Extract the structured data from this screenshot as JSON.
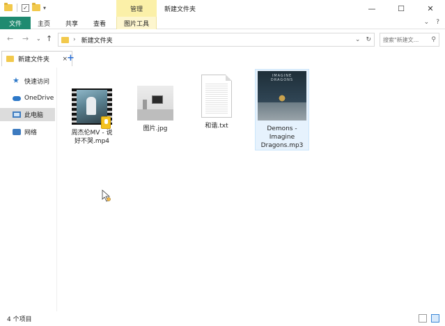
{
  "window": {
    "title": "新建文件夹",
    "context_tab_group": "管理",
    "controls": {
      "minimize": "—",
      "maximize": "☐",
      "close": "✕"
    }
  },
  "quick_access_toolbar": {
    "caret": "▾"
  },
  "ribbon": {
    "tabs": [
      {
        "label": "文件",
        "active": true
      },
      {
        "label": "主页"
      },
      {
        "label": "共享"
      },
      {
        "label": "查看"
      },
      {
        "label": "图片工具",
        "contextual": true
      }
    ],
    "right": {
      "collapse": "⌄",
      "help": "?"
    }
  },
  "address_bar": {
    "path": "新建文件夹",
    "chevron": "›",
    "dropdown": "⌄",
    "refresh": "↻"
  },
  "nav": {
    "back": "←",
    "forward": "→",
    "recent": "⌄",
    "up": "↑"
  },
  "search": {
    "placeholder": "搜索\"新建文...",
    "icon": "⚲"
  },
  "tab_strip": {
    "tabs": [
      {
        "label": "新建文件夹",
        "close": "×"
      }
    ],
    "new_tab": "+"
  },
  "sidebar": {
    "items": [
      {
        "label": "快速访问",
        "icon": "star-icon"
      },
      {
        "label": "OneDrive",
        "icon": "cloud-icon"
      },
      {
        "label": "此电脑",
        "icon": "computer-icon",
        "selected": true
      },
      {
        "label": "网络",
        "icon": "network-icon"
      }
    ]
  },
  "files": [
    {
      "name_line1": "周杰伦MV - 说",
      "name_line2": "好不哭.mp4",
      "type": "video"
    },
    {
      "name_line1": "图片.jpg",
      "type": "image"
    },
    {
      "name_line1": "和谐.txt",
      "type": "text"
    },
    {
      "name_line1": "Demons -",
      "name_line2": "Imagine",
      "name_line3": "Dragons.mp3",
      "type": "audio",
      "selected": true,
      "album_text": "IMAGINE DRAGONS"
    }
  ],
  "status": {
    "count": "4 个项目"
  }
}
